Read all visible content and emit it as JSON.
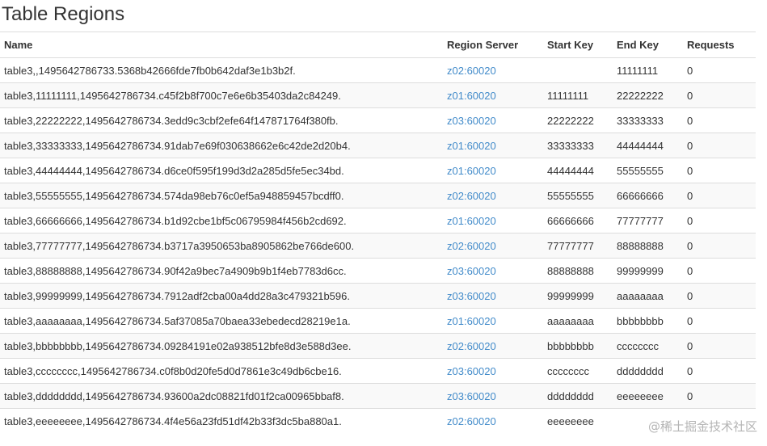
{
  "page": {
    "title": "Table Regions"
  },
  "table": {
    "headers": {
      "name": "Name",
      "server": "Region Server",
      "start_key": "Start Key",
      "end_key": "End Key",
      "requests": "Requests"
    },
    "rows": [
      {
        "name": "table3,,1495642786733.5368b42666fde7fb0b642daf3e1b3b2f.",
        "server": "z02:60020",
        "start_key": "",
        "end_key": "11111111",
        "requests": "0"
      },
      {
        "name": "table3,11111111,1495642786734.c45f2b8f700c7e6e6b35403da2c84249.",
        "server": "z01:60020",
        "start_key": "11111111",
        "end_key": "22222222",
        "requests": "0"
      },
      {
        "name": "table3,22222222,1495642786734.3edd9c3cbf2efe64f147871764f380fb.",
        "server": "z03:60020",
        "start_key": "22222222",
        "end_key": "33333333",
        "requests": "0"
      },
      {
        "name": "table3,33333333,1495642786734.91dab7e69f030638662e6c42de2d20b4.",
        "server": "z01:60020",
        "start_key": "33333333",
        "end_key": "44444444",
        "requests": "0"
      },
      {
        "name": "table3,44444444,1495642786734.d6ce0f595f199d3d2a285d5fe5ec34bd.",
        "server": "z01:60020",
        "start_key": "44444444",
        "end_key": "55555555",
        "requests": "0"
      },
      {
        "name": "table3,55555555,1495642786734.574da98eb76c0ef5a948859457bcdff0.",
        "server": "z02:60020",
        "start_key": "55555555",
        "end_key": "66666666",
        "requests": "0"
      },
      {
        "name": "table3,66666666,1495642786734.b1d92cbe1bf5c06795984f456b2cd692.",
        "server": "z01:60020",
        "start_key": "66666666",
        "end_key": "77777777",
        "requests": "0"
      },
      {
        "name": "table3,77777777,1495642786734.b3717a3950653ba8905862be766de600.",
        "server": "z02:60020",
        "start_key": "77777777",
        "end_key": "88888888",
        "requests": "0"
      },
      {
        "name": "table3,88888888,1495642786734.90f42a9bec7a4909b9b1f4eb7783d6cc.",
        "server": "z03:60020",
        "start_key": "88888888",
        "end_key": "99999999",
        "requests": "0"
      },
      {
        "name": "table3,99999999,1495642786734.7912adf2cba00a4dd28a3c479321b596.",
        "server": "z03:60020",
        "start_key": "99999999",
        "end_key": "aaaaaaaa",
        "requests": "0"
      },
      {
        "name": "table3,aaaaaaaa,1495642786734.5af37085a70baea33ebedecd28219e1a.",
        "server": "z01:60020",
        "start_key": "aaaaaaaa",
        "end_key": "bbbbbbbb",
        "requests": "0"
      },
      {
        "name": "table3,bbbbbbbb,1495642786734.09284191e02a938512bfe8d3e588d3ee.",
        "server": "z02:60020",
        "start_key": "bbbbbbbb",
        "end_key": "cccccccc",
        "requests": "0"
      },
      {
        "name": "table3,cccccccc,1495642786734.c0f8b0d20fe5d0d7861e3c49db6cbe16.",
        "server": "z03:60020",
        "start_key": "cccccccc",
        "end_key": "dddddddd",
        "requests": "0"
      },
      {
        "name": "table3,dddddddd,1495642786734.93600a2dc08821fd01f2ca00965bbaf8.",
        "server": "z03:60020",
        "start_key": "dddddddd",
        "end_key": "eeeeeeee",
        "requests": "0"
      },
      {
        "name": "table3,eeeeeeee,1495642786734.4f4e56a23fd51df42b33f3dc5ba880a1.",
        "server": "z02:60020",
        "start_key": "eeeeeeee",
        "end_key": "",
        "requests": ""
      }
    ]
  },
  "watermark": {
    "text": "@稀土掘金技术社区"
  },
  "colors": {
    "link": "#428bca",
    "text": "#333333",
    "border": "#dddddd",
    "stripe": "#f9f9f9"
  }
}
